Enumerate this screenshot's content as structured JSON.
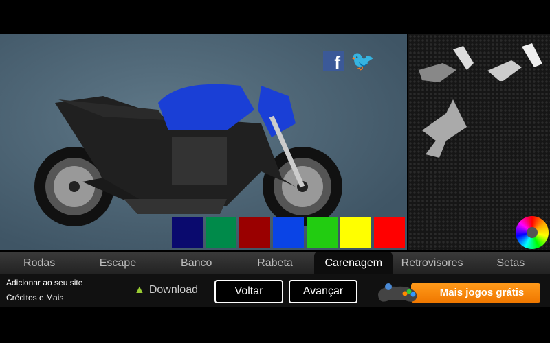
{
  "social": {
    "facebook": "f",
    "twitter": "🐦"
  },
  "swatches": [
    "#0a0a6e",
    "#008a4a",
    "#9a0000",
    "#0a44e6",
    "#22cc11",
    "#ffff00",
    "#ff0000",
    "#bbbbbb",
    "#0c0c0c",
    "#eeeeee"
  ],
  "bike_color": "#1a3fd6",
  "tabs": [
    {
      "label": "Rodas"
    },
    {
      "label": "Escape"
    },
    {
      "label": "Banco"
    },
    {
      "label": "Rabeta"
    },
    {
      "label": "Carenagem",
      "active": true
    },
    {
      "label": "Retrovisores"
    },
    {
      "label": "Setas"
    }
  ],
  "footer": {
    "add_site": "Adicionar ao seu site",
    "credits": "Créditos e Mais",
    "download": "Download",
    "back": "Voltar",
    "next": "Avançar",
    "more_games": "Mais jogos grátis"
  }
}
